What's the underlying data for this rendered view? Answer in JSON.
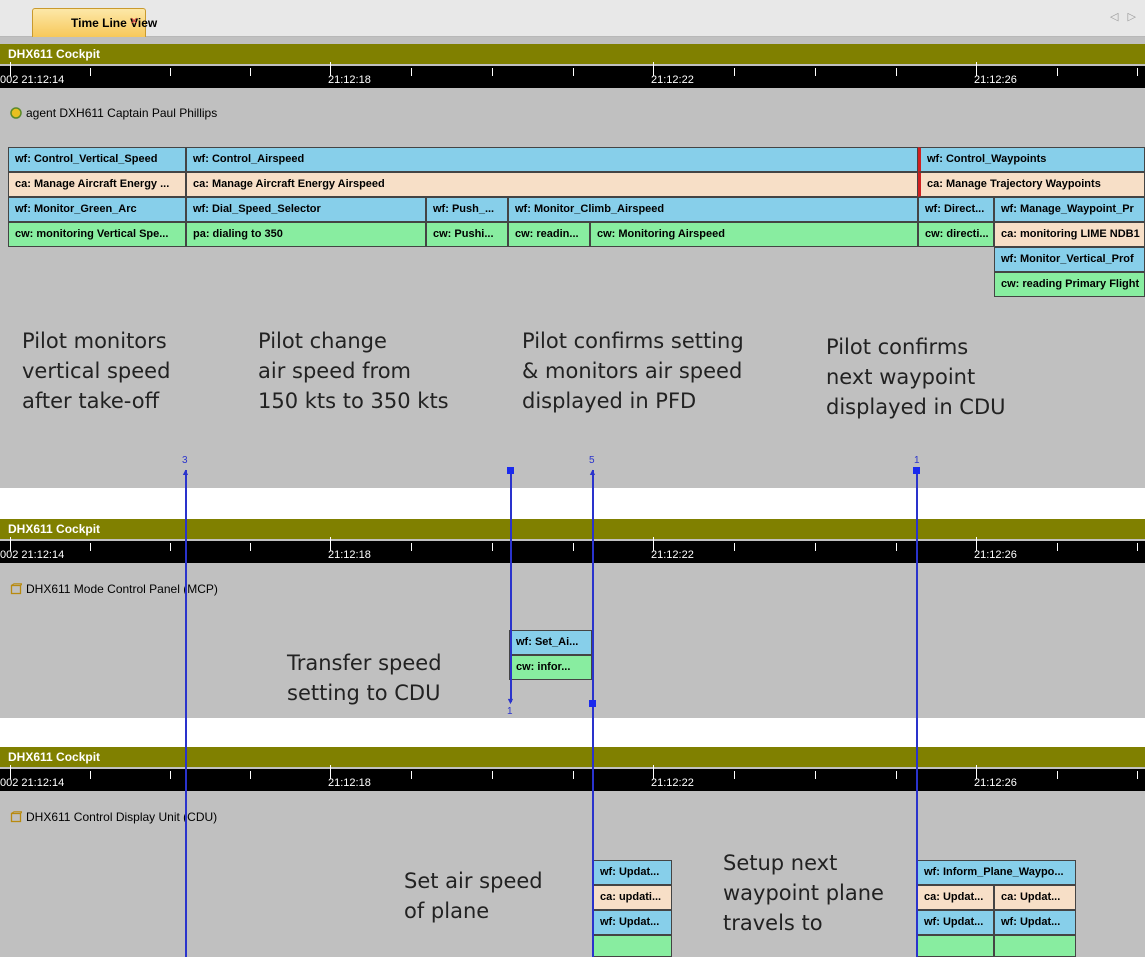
{
  "tab": {
    "label": "Time Line View",
    "close": "×"
  },
  "nav_arrows": "◁ ▷",
  "timeline": {
    "start_label": "002 21:12:14",
    "labels": [
      "21:12:18",
      "21:12:22",
      "21:12:26"
    ]
  },
  "panels": [
    {
      "title": "DHX611 Cockpit",
      "agent": "agent DXH611 Captain Paul Phillips"
    },
    {
      "title": "DHX611 Cockpit",
      "agent": "DHX611 Mode Control Panel (MCP)"
    },
    {
      "title": "DHX611 Cockpit",
      "agent": "DHX611 Control Display Unit (CDU)"
    }
  ],
  "p1": {
    "row1": {
      "a": "wf: Control_Vertical_Speed",
      "b": "wf: Control_Airspeed",
      "c": "wf: Control_Waypoints"
    },
    "row2": {
      "a": "ca: Manage Aircraft Energy ...",
      "b": "ca: Manage Aircraft Energy Airspeed",
      "c": "ca: Manage Trajectory Waypoints"
    },
    "row3": {
      "a": "wf: Monitor_Green_Arc",
      "b": "wf: Dial_Speed_Selector",
      "c": "wf: Push_...",
      "d": "wf: Monitor_Climb_Airspeed",
      "e": "wf: Direct...",
      "f": "wf: Manage_Waypoint_Pr"
    },
    "row4": {
      "a": "cw: monitoring Vertical Spe...",
      "b": "pa: dialing to 350",
      "c": "cw: Pushi...",
      "d": "cw: readin...",
      "e": "cw: Monitoring Airspeed",
      "f": "cw: directi...",
      "g": "ca: monitoring LIME NDB1"
    },
    "row5": {
      "g": "wf: Monitor_Vertical_Prof"
    },
    "row6": {
      "g": "cw: reading Primary Flight"
    }
  },
  "p2": {
    "a": "wf: Set_Ai...",
    "b": "cw: infor..."
  },
  "p3": {
    "a1": "wf: Updat...",
    "a2": "ca: updati...",
    "a3": "wf: Updat...",
    "b1": "wf: Inform_Plane_Waypo...",
    "b2": "ca: Updat...",
    "b3": "ca: Updat...",
    "b4": "wf: Updat...",
    "b5": "wf: Updat..."
  },
  "annotations": {
    "a1": "Pilot monitors\nvertical speed\nafter take-off",
    "a2": "Pilot change\nair speed from\n150 kts to 350 kts",
    "a3": "Pilot confirms setting\n& monitors air speed\ndisplayed in PFD",
    "a4": "Pilot confirms\nnext waypoint\ndisplayed in CDU",
    "a5": "Transfer speed\nsetting to CDU",
    "a6": "Set air speed\nof plane",
    "a7": "Setup next\nwaypoint plane\ntravels to"
  },
  "link_numbers": {
    "n3": "3",
    "n5": "5",
    "n1a": "1",
    "n1b": "1"
  },
  "colors": {
    "panel_title": "#808000",
    "wf": "#87cfea",
    "ca": "#f7dfc7",
    "cw": "#88eda0",
    "link": "#2a33cc"
  }
}
